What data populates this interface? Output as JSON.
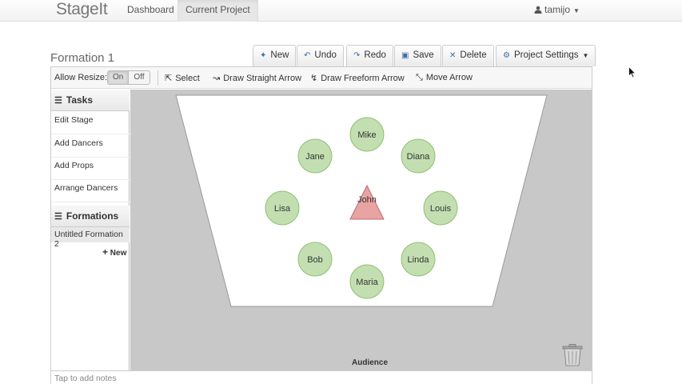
{
  "navbar": {
    "brand": "StageIt",
    "links": [
      "Dashboard",
      "Current Project"
    ],
    "user": "tamijo"
  },
  "formation": {
    "title": "Formation 1"
  },
  "toolbar": {
    "new": "New",
    "undo": "Undo",
    "redo": "Redo",
    "save": "Save",
    "delete": "Delete",
    "settings": "Project Settings"
  },
  "tools": {
    "allow_resize": "Allow Resize:",
    "on": "On",
    "off": "Off",
    "select": "Select",
    "straight_arrow": "Draw Straight Arrow",
    "freeform_arrow": "Draw Freeform Arrow",
    "move_arrow": "Move Arrow"
  },
  "sidebar": {
    "tasks_header": "Tasks",
    "tasks": [
      "Edit Stage",
      "Add Dancers",
      "Add Props",
      "Arrange Dancers"
    ],
    "formations_header": "Formations",
    "formations": [
      "Untitled Formation 2"
    ],
    "new_label": "New"
  },
  "stage": {
    "dancers": [
      {
        "name": "Mike",
        "shape": "circle"
      },
      {
        "name": "Jane",
        "shape": "circle"
      },
      {
        "name": "Diana",
        "shape": "circle"
      },
      {
        "name": "Lisa",
        "shape": "circle"
      },
      {
        "name": "John",
        "shape": "triangle"
      },
      {
        "name": "Louis",
        "shape": "circle"
      },
      {
        "name": "Bob",
        "shape": "circle"
      },
      {
        "name": "Linda",
        "shape": "circle"
      },
      {
        "name": "Maria",
        "shape": "circle"
      }
    ],
    "audience_label": "Audience",
    "notes_placeholder": "Tap to add notes",
    "colors": {
      "dancer_fill": "#c3dfb1",
      "dancer_stroke": "#8fbf73",
      "lead_fill": "#e8a3a3",
      "lead_stroke": "#c06a6a",
      "floor": "#c8c8c8"
    }
  }
}
